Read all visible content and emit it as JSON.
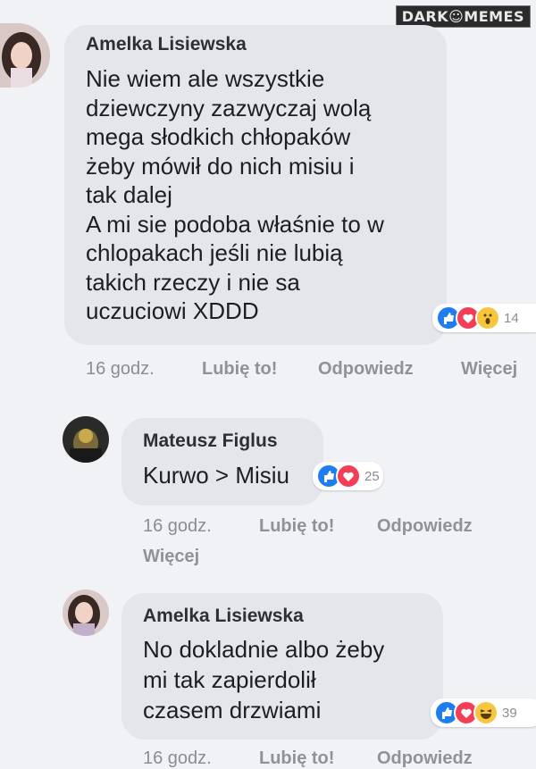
{
  "watermark": "DARK☺MEMES",
  "comments": [
    {
      "author": "Amelka Lisiewska",
      "lines": [
        "Nie wiem ale wszystkie",
        "dziewczyny zazwyczaj wolą",
        "mega słodkich chłopaków",
        "żeby mówił do nich misiu i",
        "tak dalej",
        "A mi sie podoba właśnie to w",
        "chlopakach jeśli nie lubią",
        "takich rzeczy i nie sa",
        "uczuciowi XDDD"
      ],
      "reaction_count": "14",
      "reactions": [
        "like-icon",
        "love-icon",
        "wow-icon"
      ],
      "time": "16 godz.",
      "like": "Lubię to!",
      "reply": "Odpowiedz",
      "more": "Więcej"
    },
    {
      "author": "Mateusz Figlus",
      "lines": [
        "Kurwo > Misiu"
      ],
      "reaction_count": "25",
      "reactions": [
        "like-icon",
        "love-icon"
      ],
      "time": "16 godz.",
      "like": "Lubię to!",
      "reply": "Odpowiedz",
      "more": "Więcej"
    },
    {
      "author": "Amelka Lisiewska",
      "lines": [
        "No dokladnie albo żeby",
        "mi tak zapierdolił",
        "czasem drzwiami"
      ],
      "reaction_count": "39",
      "reactions": [
        "like-icon",
        "love-icon",
        "haha-icon"
      ],
      "time": "16 godz.",
      "like": "Lubię to!",
      "reply": "Odpowiedz"
    }
  ],
  "colors": {
    "bubble": "#e4e6eb",
    "background": "#f1f2f5",
    "like": "#1d7df1",
    "love": "#f33e58",
    "wow": "#f7c63f"
  }
}
